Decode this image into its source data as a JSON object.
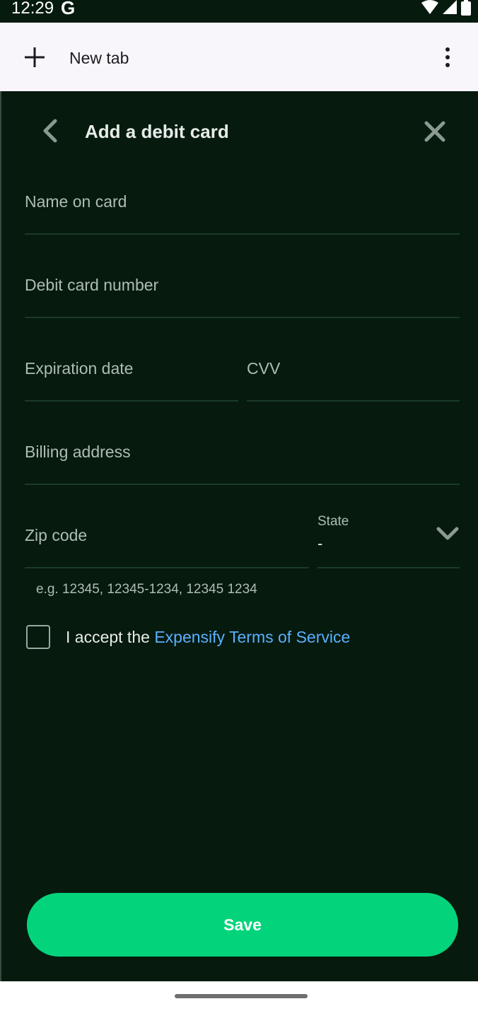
{
  "status_bar": {
    "time": "12:29",
    "g_label": "G",
    "icons": [
      "wifi-icon",
      "signal-icon",
      "battery-icon"
    ]
  },
  "browser": {
    "new_tab_label": "New tab",
    "icons": [
      "plus-icon",
      "more-vert-icon"
    ]
  },
  "header": {
    "title": "Add a debit card",
    "icons": [
      "chevron-left-icon",
      "close-icon"
    ]
  },
  "form": {
    "name_on_card": {
      "label": "Name on card",
      "value": ""
    },
    "card_number": {
      "label": "Debit card number",
      "value": ""
    },
    "expiration_date": {
      "label": "Expiration date",
      "value": ""
    },
    "cvv": {
      "label": "CVV",
      "value": ""
    },
    "billing_address": {
      "label": "Billing address",
      "value": ""
    },
    "zip_code": {
      "label": "Zip code",
      "value": "",
      "hint": "e.g. 12345, 12345-1234, 12345 1234"
    },
    "state": {
      "label": "State",
      "value": "-"
    }
  },
  "terms": {
    "checked": false,
    "prefix": "I accept the ",
    "link_text": "Expensify Terms of Service"
  },
  "save_label": "Save",
  "colors": {
    "background": "#061a0e",
    "accent_green": "#03d47c",
    "link_blue": "#5ab0ff",
    "text_primary": "#e7ece9",
    "text_secondary": "#aebdb3"
  }
}
